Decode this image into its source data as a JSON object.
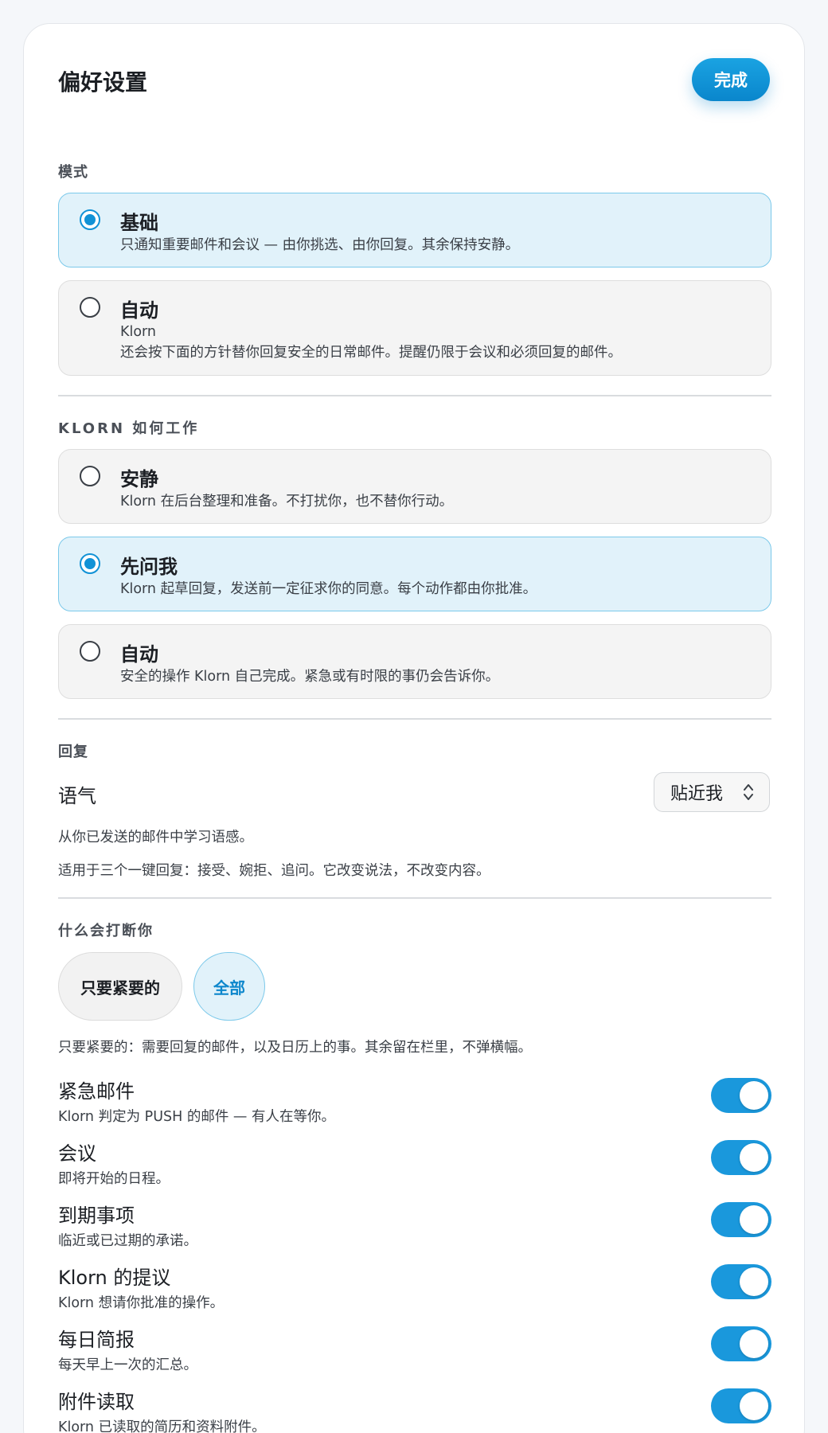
{
  "header": {
    "title": "偏好设置",
    "done_label": "完成"
  },
  "mode": {
    "section_label": "模式",
    "options": [
      {
        "title": "基础",
        "desc": [
          "只通知重要邮件和会议 — 由你挑选、由你回复。其余保持安静。"
        ],
        "selected": true
      },
      {
        "title": "自动",
        "desc": [
          "Klorn",
          "还会按下面的方针替你回复安全的日常邮件。提醒仍限于会议和必须回复的邮件。"
        ],
        "selected": false
      }
    ]
  },
  "how": {
    "section_label": "KLORN 如何工作",
    "options": [
      {
        "title": "安静",
        "desc": [
          "Klorn 在后台整理和准备。不打扰你，也不替你行动。"
        ],
        "selected": false
      },
      {
        "title": "先问我",
        "desc": [
          "Klorn 起草回复，发送前一定征求你的同意。每个动作都由你批准。"
        ],
        "selected": true
      },
      {
        "title": "自动",
        "desc": [
          "安全的操作 Klorn 自己完成。紧急或有时限的事仍会告诉你。"
        ],
        "selected": false
      }
    ]
  },
  "reply": {
    "section_label": "回复",
    "tone_label": "语气",
    "tone_value": "贴近我",
    "desc1": "从你已发送的邮件中学习语感。",
    "desc2": "适用于三个一键回复：接受、婉拒、追问。它改变说法，不改变内容。"
  },
  "interrupt": {
    "section_label": "什么会打断你",
    "pill_urgent": "只要紧要的",
    "pill_all": "全部",
    "selected": "全部",
    "note": "只要紧要的：需要回复的邮件，以及日历上的事。其余留在栏里，不弹横幅。",
    "items": [
      {
        "title": "紧急邮件",
        "sub": "Klorn 判定为 PUSH 的邮件 — 有人在等你。",
        "on": true
      },
      {
        "title": "会议",
        "sub": "即将开始的日程。",
        "on": true
      },
      {
        "title": "到期事项",
        "sub": "临近或已过期的承诺。",
        "on": true
      },
      {
        "title": "Klorn 的提议",
        "sub": "Klorn 想请你批准的操作。",
        "on": true
      },
      {
        "title": "每日简报",
        "sub": "每天早上一次的汇总。",
        "on": true
      },
      {
        "title": "附件读取",
        "sub": "Klorn 已读取的简历和资料附件。",
        "on": true
      }
    ]
  },
  "colors": {
    "accent": "#1192d6",
    "selected_bg": "#e1f2fa",
    "toggle_on": "#1a98dc"
  }
}
